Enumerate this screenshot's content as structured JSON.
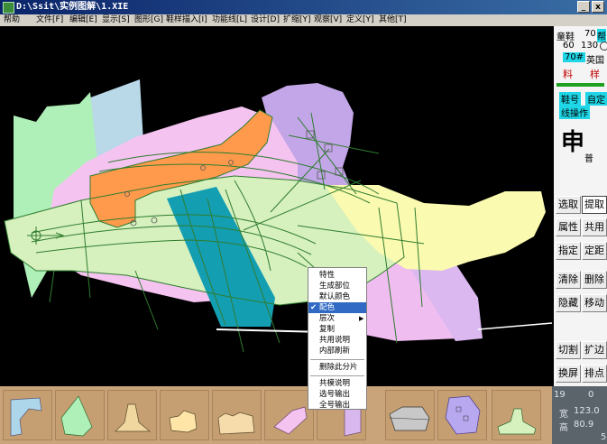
{
  "window": {
    "title": "D:\\Ssit\\实例图解\\1.XIE",
    "minimize": "_",
    "close": "x"
  },
  "menu": [
    "帮助",
    "文件[F]",
    "编辑[E]",
    "显示[S]",
    "图形[G]",
    "鞋样描入[I]",
    "功能线[L]",
    "设计[D]",
    "扩缩[Y]",
    "观察[V]",
    "定义[Y]",
    "其他[T]"
  ],
  "side": {
    "shoe_type": "童鞋",
    "size_num": "70",
    "size_sys": "帮",
    "r2a": "60",
    "r2b": "130",
    "size_tag": "70#",
    "unit": "英国",
    "tab1": "料",
    "tab2": "样",
    "label_a": "鞋号",
    "label_b": "自定",
    "label_c": "线操作",
    "logo_char": "申",
    "logo_small": "普"
  },
  "tools": [
    "选取",
    "提取",
    "属性",
    "共用",
    "指定",
    "定距",
    "清除",
    "删除",
    "隐藏",
    "移动",
    "切割",
    "扩边",
    "换屏",
    "排点"
  ],
  "context_menu": {
    "items": [
      "特性",
      "生成部位",
      "默认颜色",
      "配色",
      "层次",
      "复制",
      "共用说明",
      "内部刷新",
      "删除此分片",
      "共模说明",
      "选号输出",
      "全号输出"
    ],
    "selected_index": 3
  },
  "status": {
    "page": "19",
    "page2": "0",
    "width_label": "宽",
    "width_value": "123.0",
    "height_label": "高",
    "height_value": "80.9",
    "edge": "5"
  },
  "icons": [
    "app-icon",
    "minimize-icon",
    "close-icon",
    "checkmark-icon",
    "submenu-arrow-icon",
    "logo-seal-icon"
  ]
}
